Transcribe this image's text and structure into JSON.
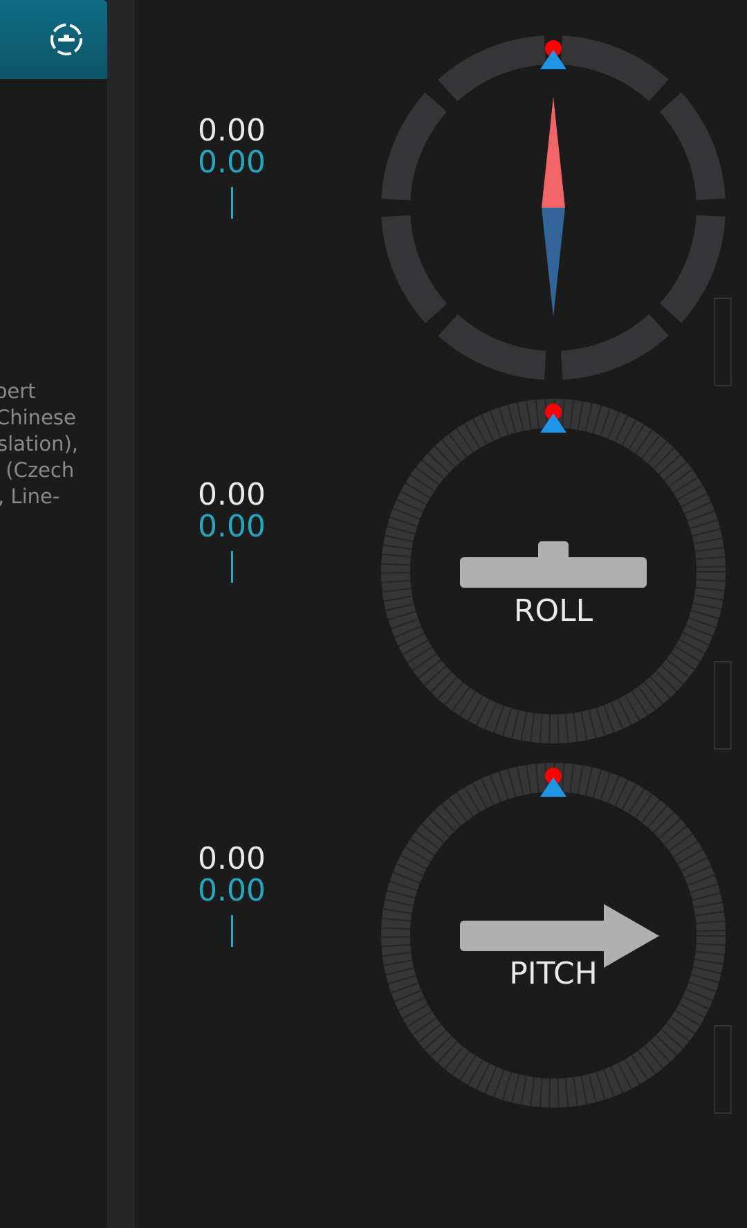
{
  "drawer": {
    "header_icon": "target-disc-icon",
    "credits_lines": [
      "bert",
      "Chinese",
      "slation),",
      "l (Czech",
      ", Line-"
    ]
  },
  "sensors": [
    {
      "name": "heading",
      "value": "0.00",
      "raw": "0.00",
      "label": "",
      "icon": "compass-needle-icon",
      "level": 0
    },
    {
      "name": "roll",
      "value": "0.00",
      "raw": "0.00",
      "label": "ROLL",
      "icon": "level-bar-icon",
      "level": 0
    },
    {
      "name": "pitch",
      "value": "0.00",
      "raw": "0.00",
      "label": "PITCH",
      "icon": "arrow-right-icon",
      "level": 0
    }
  ],
  "colors": {
    "accent": "#22a8c2",
    "north": "#f26467",
    "south": "#33649a",
    "marker_dot": "#ff0000",
    "marker_tri": "#1e96e8",
    "ring": "#353537"
  }
}
